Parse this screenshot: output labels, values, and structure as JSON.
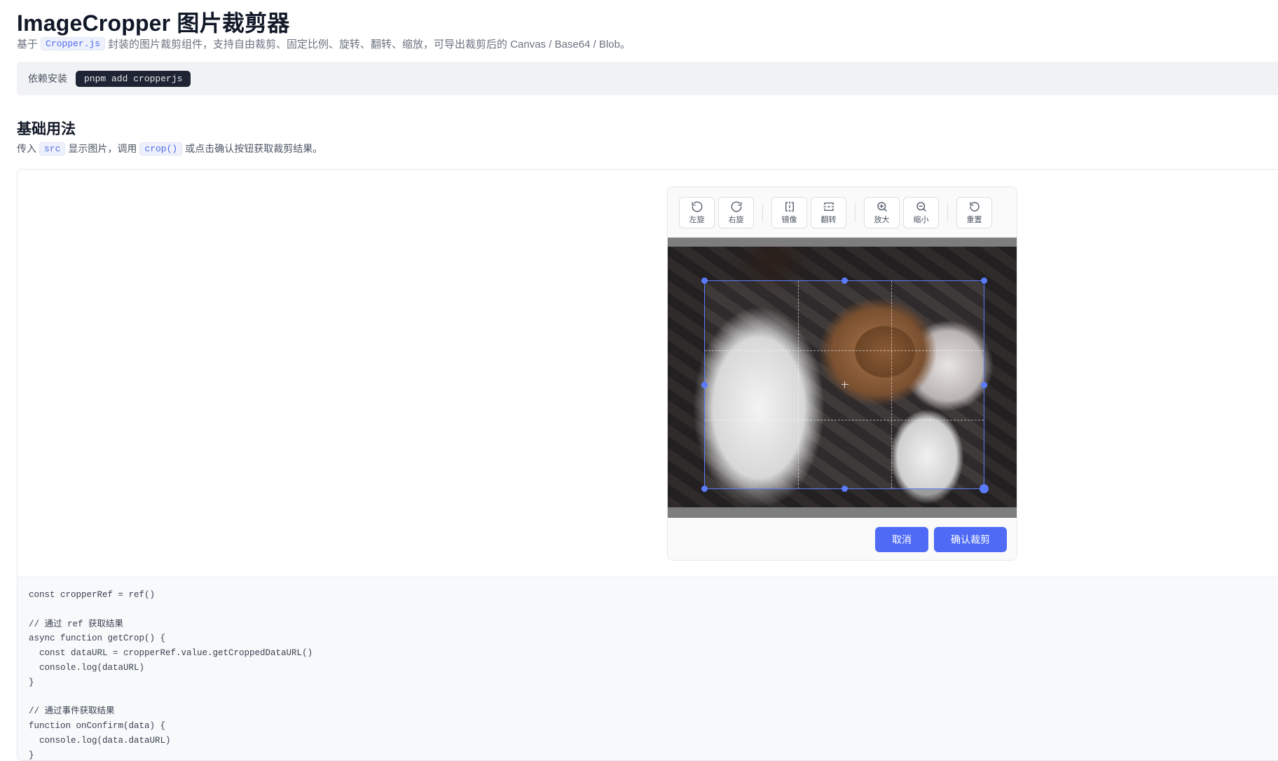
{
  "page": {
    "title": "ImageCropper 图片裁剪器",
    "subtitle_prefix": "基于",
    "subtitle_code": "Cropper.js",
    "subtitle_suffix": "封装的图片裁剪组件，支持自由裁剪、固定比例、旋转、翻转、缩放，可导出裁剪后的 Canvas / Base64 / Blob。"
  },
  "dependency": {
    "label": "依赖安装",
    "command": "pnpm add cropperjs"
  },
  "section": {
    "title": "基础用法",
    "desc_1": "传入",
    "desc_code_1": "src",
    "desc_2": "显示图片，调用",
    "desc_code_2": "crop()",
    "desc_3": "或点击确认按钮获取裁剪结果。"
  },
  "toolbar": {
    "rotate_left": "左旋",
    "rotate_right": "右旋",
    "mirror": "镜像",
    "flip": "翻转",
    "zoom_in": "放大",
    "zoom_out": "缩小",
    "reset": "重置"
  },
  "actions": {
    "cancel": "取消",
    "confirm": "确认裁剪"
  },
  "code_lines": [
    "const cropperRef = ref()",
    "",
    "// 通过 ref 获取结果",
    "async function getCrop() {",
    "  const dataURL = cropperRef.value.getCroppedDataURL()",
    "  console.log(dataURL)",
    "}",
    "",
    "// 通过事件获取结果",
    "function onConfirm(data) {",
    "  console.log(data.dataURL)",
    "}"
  ],
  "colors": {
    "accent": "#4f6bf5",
    "crop_border": "#5b7bff"
  }
}
